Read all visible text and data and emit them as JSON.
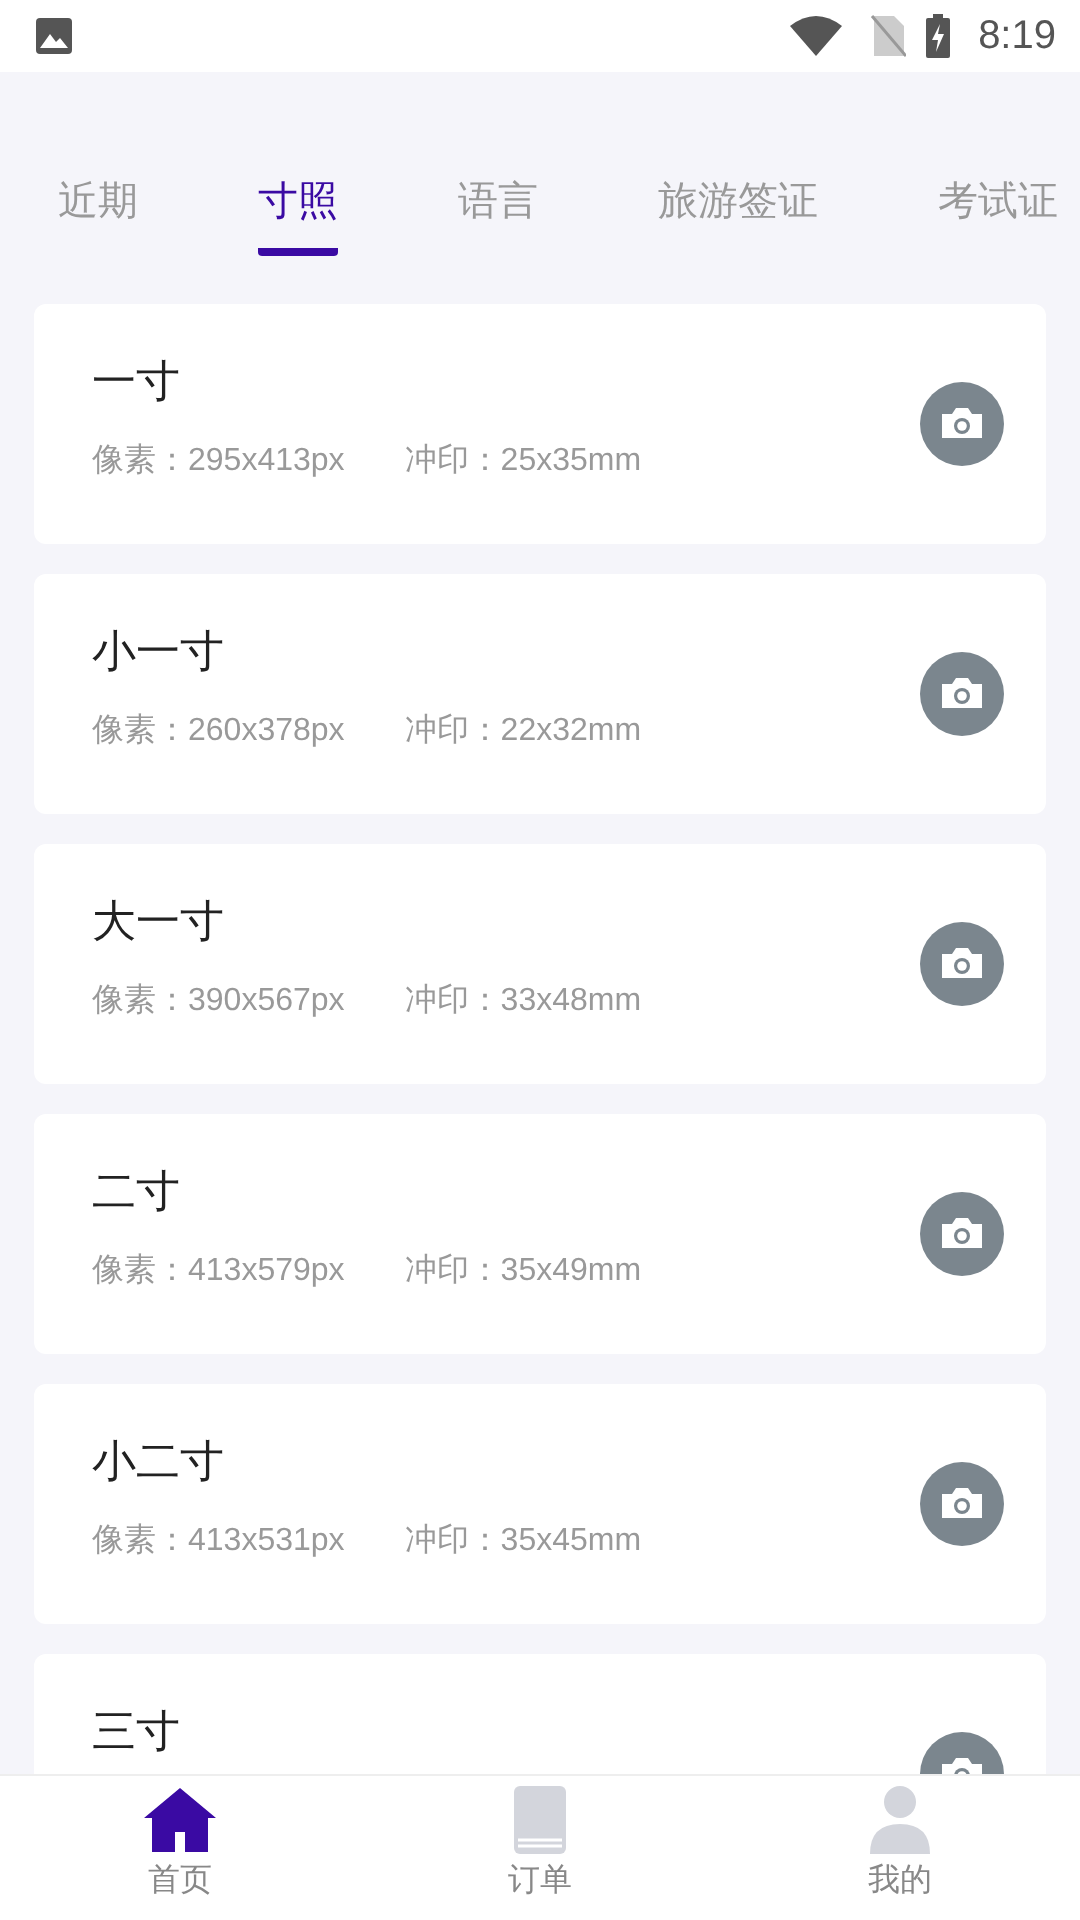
{
  "status_bar": {
    "time": "8:19"
  },
  "tabs": [
    {
      "label": "近期",
      "selected": false
    },
    {
      "label": "寸照",
      "selected": true
    },
    {
      "label": "语言",
      "selected": false
    },
    {
      "label": "旅游签证",
      "selected": false
    },
    {
      "label": "考试证",
      "selected": false
    }
  ],
  "cards": [
    {
      "title": "一寸",
      "pixels": "像素：295x413px",
      "print": "冲印：25x35mm"
    },
    {
      "title": "小一寸",
      "pixels": "像素：260x378px",
      "print": "冲印：22x32mm"
    },
    {
      "title": "大一寸",
      "pixels": "像素：390x567px",
      "print": "冲印：33x48mm"
    },
    {
      "title": "二寸",
      "pixels": "像素：413x579px",
      "print": "冲印：35x49mm"
    },
    {
      "title": "小二寸",
      "pixels": "像素：413x531px",
      "print": "冲印：35x45mm"
    },
    {
      "title": "三寸"
    }
  ],
  "bottom_nav": [
    {
      "label": "首页",
      "kind": "home",
      "selected": true
    },
    {
      "label": "订单",
      "kind": "book",
      "selected": false
    },
    {
      "label": "我的",
      "kind": "person",
      "selected": false
    }
  ]
}
